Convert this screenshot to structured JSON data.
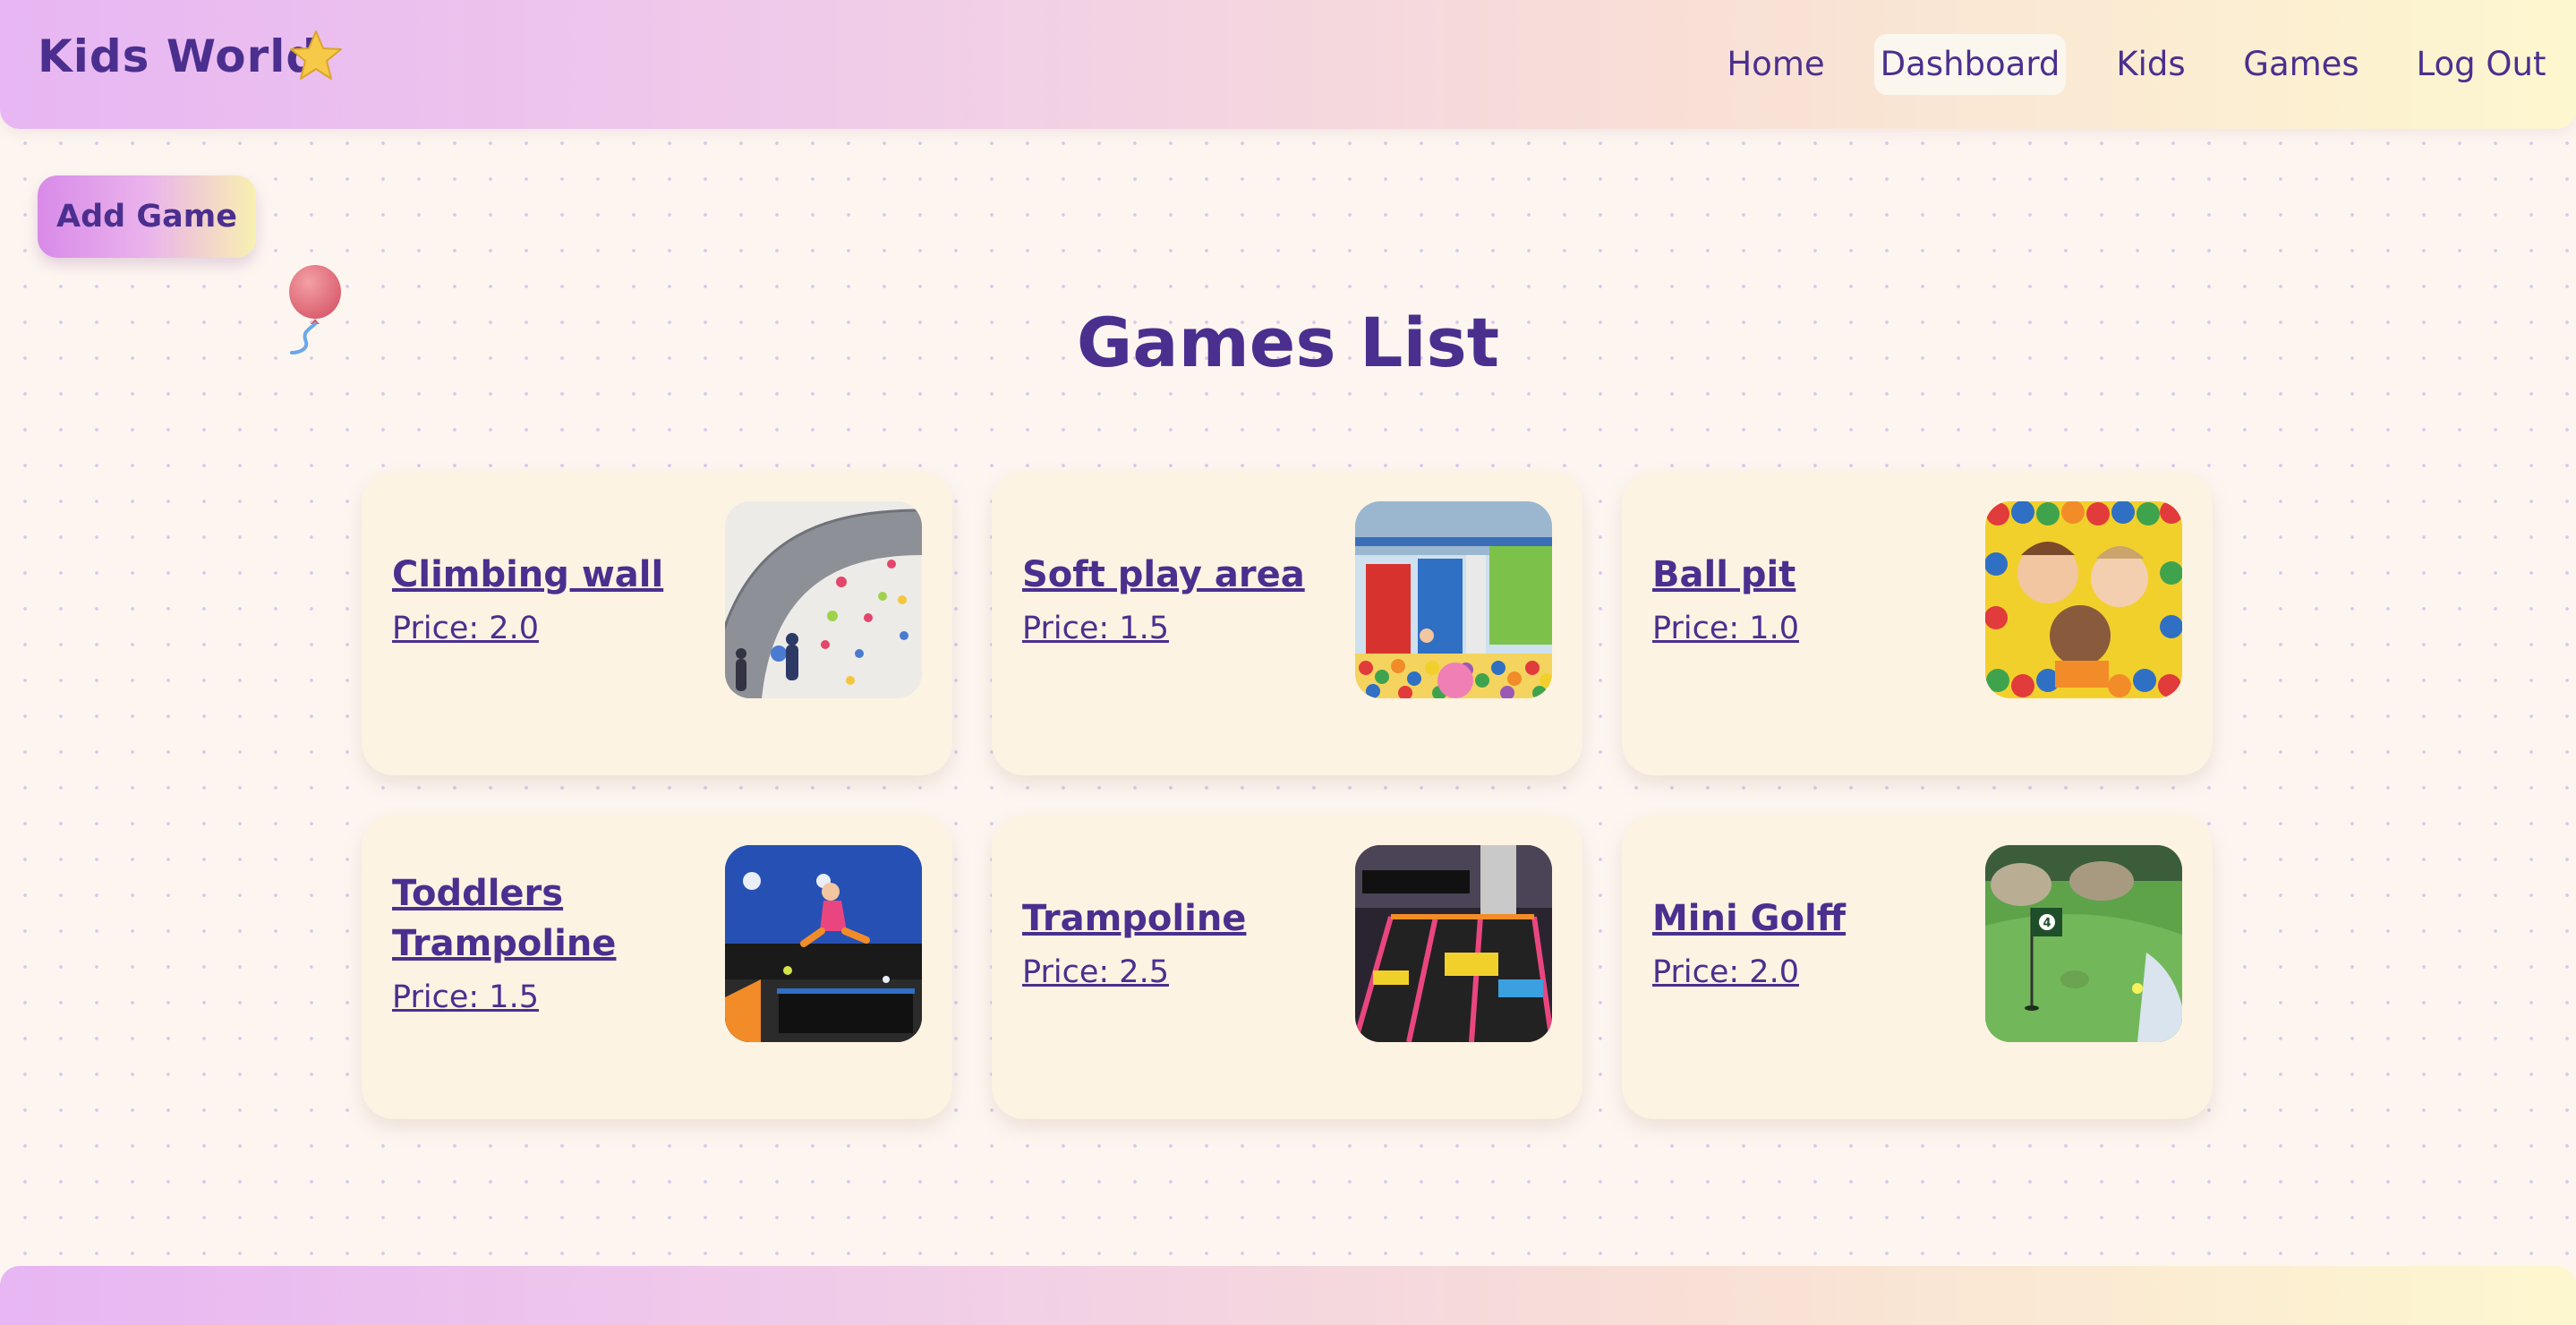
{
  "header": {
    "brand": "Kids World",
    "nav": [
      "Home",
      "Dashboard",
      "Kids",
      "Games",
      "Log Out"
    ],
    "active_nav": "Dashboard"
  },
  "actions": {
    "add_game_label": "Add Game"
  },
  "page": {
    "title": "Games List"
  },
  "games": [
    {
      "name": "Climbing wall",
      "price": "Price: 2.0",
      "icon": "climbing-wall-photo"
    },
    {
      "name": "Soft play area",
      "price": "Price: 1.5",
      "icon": "soft-play-area-photo"
    },
    {
      "name": "Ball pit",
      "price": "Price: 1.0",
      "icon": "ball-pit-photo"
    },
    {
      "name": "Toddlers Trampoline",
      "price": "Price: 1.5",
      "icon": "toddlers-trampoline-photo"
    },
    {
      "name": "Trampoline",
      "price": "Price: 2.5",
      "icon": "trampoline-photo"
    },
    {
      "name": "Mini Golff",
      "price": "Price: 2.0",
      "icon": "mini-golf-photo"
    }
  ],
  "colors": {
    "text": "#4b2f8f",
    "card": "#fdf3e2",
    "background": "#fdf6f0",
    "header_gradient_start": "#e7b6f3",
    "header_gradient_end": "#fdf7cf"
  }
}
